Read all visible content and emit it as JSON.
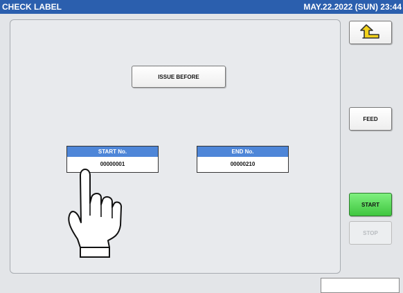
{
  "header": {
    "title": "CHECK LABEL",
    "datetime": "MAY.22.2022 (SUN)  23:44"
  },
  "main": {
    "issue_label": "ISSUE BEFORE",
    "start_no": {
      "label": "START No.",
      "value": "00000001"
    },
    "end_no": {
      "label": "END No.",
      "value": "00000210"
    }
  },
  "side": {
    "back_icon": "return-arrow-icon",
    "feed_label": "FEED",
    "start_label": "START",
    "stop_label": "STOP"
  },
  "colors": {
    "title_bar": "#2b5fae",
    "field_header": "#4e86d8",
    "start_button": "#3fc63f"
  },
  "overlay": {
    "icon": "pointing-hand-icon"
  }
}
